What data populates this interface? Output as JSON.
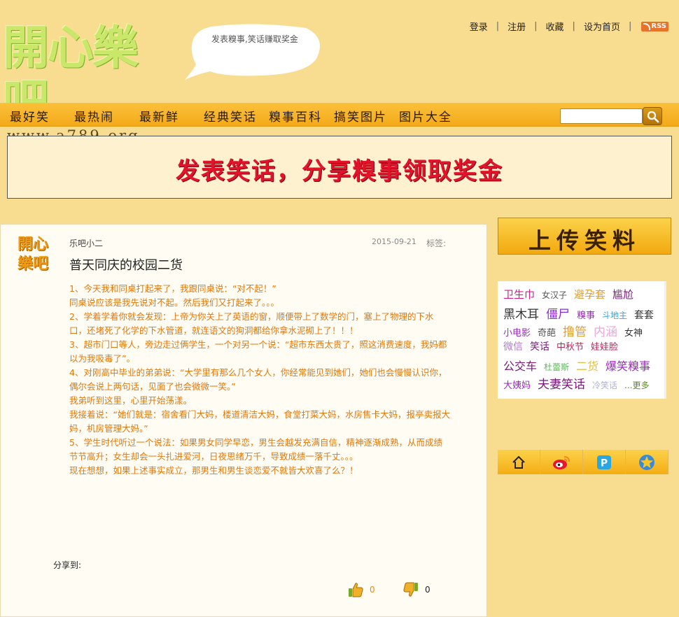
{
  "header": {
    "logo_title": "開心樂吧",
    "logo_url": "www.a789.org",
    "bubble_text": "发表糗事,笑话赚取奖金",
    "links": [
      "登录",
      "注册",
      "收藏",
      "设为首页"
    ],
    "rss_label": "RSS"
  },
  "nav": {
    "items": [
      "最好笑",
      "最热闹",
      "最新鲜",
      "经典笑话",
      "糗事百科",
      "搞笑图片",
      "图片大全"
    ],
    "search_placeholder": ""
  },
  "banner": {
    "text": "发表笑话，分享糗事领取奖金"
  },
  "post": {
    "avatar_line1": "開心",
    "avatar_line2": "樂吧",
    "author": "乐吧小二",
    "date": "2015-09-21",
    "tags_label": "标签:",
    "title": "普天同庆的校园二货",
    "paragraphs": [
      "1、今天我和同桌打起来了，我跟同桌说：“对不起！”",
      "同桌说应该是我先说对不起。然后我们又打起来了。。。",
      "2、学着学着你就会发现：上帝为你关上了英语的窗，顺便带上了数学的门，塞上了物理的下水口，还堵死了化学的下水管道，就连语文的狗洞都给你拿水泥砌上了！！！",
      "3、超市门口等人，旁边走过俩学生，一个对另一个说：“超市东西太贵了，照这消费速度，我妈都以为我吸毒了”。",
      "4、对刚高中毕业的弟弟说：“大学里有那么几个女人，你经常能见到她们，她们也会慢慢认识你，偶尔会说上两句话，见面了也会微微一笑。”",
      "我弟听到这里，心里开始荡漾。",
      "我接着说：“她们就是：宿舍看门大妈，楼道清洁大妈，食堂打菜大妈，水房售卡大妈，报亭卖报大妈，机房管理大妈。”",
      "5、学生时代听过一个说法：如果男女同学早恋，男生会越发充满自信，精神逐渐成熟，从而成绩节节高升；女生却会一头扎进爱河，日夜思绪万千，导致成绩一落千丈。。。",
      "现在想想，如果上述事实成立，那男生和男生谈恋爱不就皆大欢喜了么？！"
    ],
    "share_label": "分享到:",
    "up_count": "0",
    "down_count": "0"
  },
  "sidebar": {
    "upload_label": "上传笑料",
    "tag_rows": [
      [
        {
          "text": "卫生巾",
          "color": "#d0208a",
          "size": 15
        },
        {
          "text": "女汉子",
          "color": "#555555",
          "size": 12
        },
        {
          "text": "避孕套",
          "color": "#e0a030",
          "size": 15
        },
        {
          "text": "尴尬",
          "color": "#7a1a7a",
          "size": 15
        }
      ],
      [
        {
          "text": "黑木耳",
          "color": "#333333",
          "size": 17
        },
        {
          "text": "僵尸",
          "color": "#8a2bd8",
          "size": 17
        },
        {
          "text": "糗事",
          "color": "#9a2ab8",
          "size": 13
        },
        {
          "text": "斗地主",
          "color": "#3aa6d8",
          "size": 12
        },
        {
          "text": "套套",
          "color": "#333333",
          "size": 14
        }
      ],
      [
        {
          "text": "小电影",
          "color": "#9a2ab8",
          "size": 13
        },
        {
          "text": "奇葩",
          "color": "#555555",
          "size": 13
        },
        {
          "text": "撸管",
          "color": "#e0a030",
          "size": 17
        },
        {
          "text": "内涵",
          "color": "#e8a8d8",
          "size": 17
        },
        {
          "text": "女神",
          "color": "#333333",
          "size": 13
        }
      ],
      [
        {
          "text": "微信",
          "color": "#b07ac8",
          "size": 14
        },
        {
          "text": "笑话",
          "color": "#7a1a7a",
          "size": 14
        },
        {
          "text": "中秋节",
          "color": "#b02a5a",
          "size": 13
        },
        {
          "text": "娃娃脸",
          "color": "#b02a5a",
          "size": 13
        }
      ],
      [
        {
          "text": "公交车",
          "color": "#7a1a7a",
          "size": 16
        },
        {
          "text": "杜蕾斯",
          "color": "#5ab85a",
          "size": 12
        },
        {
          "text": "二货",
          "color": "#e0c040",
          "size": 16
        },
        {
          "text": "爆笑糗事",
          "color": "#9a2ab8",
          "size": 16
        }
      ],
      [
        {
          "text": "大姨妈",
          "color": "#9a2ab8",
          "size": 13
        },
        {
          "text": "夫妻笑话",
          "color": "#7a1a7a",
          "size": 17
        },
        {
          "text": "冷笑话",
          "color": "#b0b0d8",
          "size": 12
        },
        {
          "text": "...更多",
          "color": "#5a8a2a",
          "size": 12
        }
      ]
    ],
    "share_icons": [
      "home-up-icon",
      "weibo-icon",
      "pengyou-icon",
      "qzone-icon"
    ]
  }
}
